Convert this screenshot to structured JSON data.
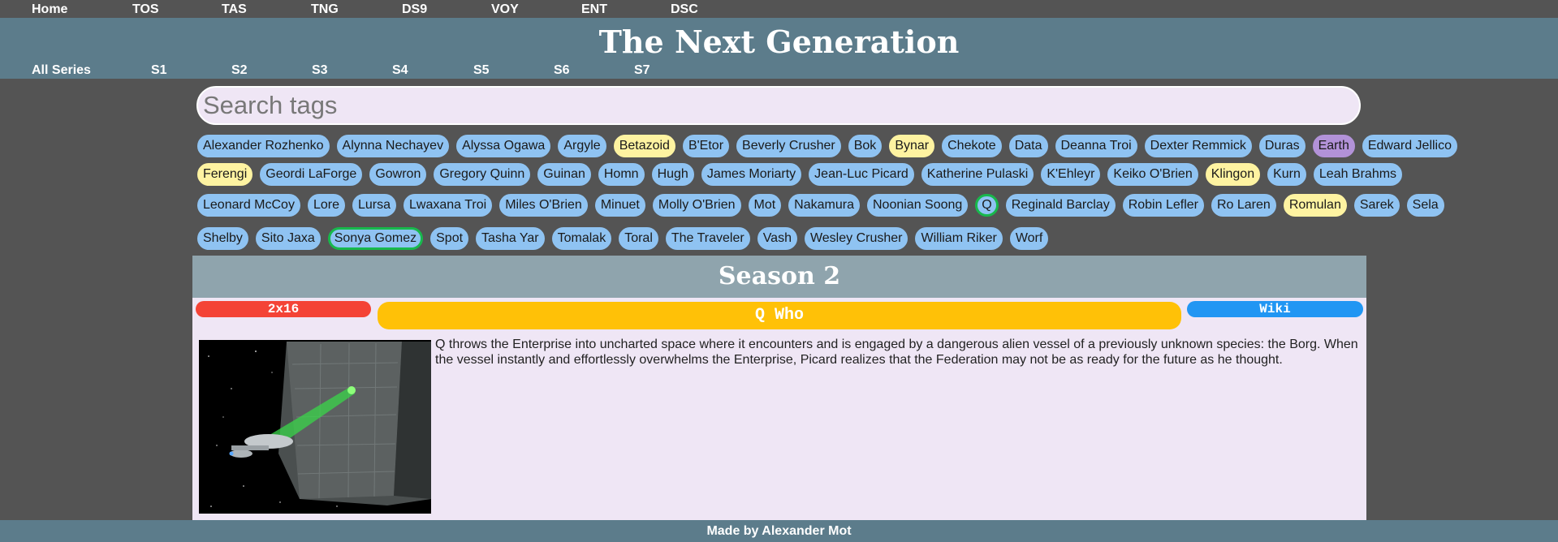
{
  "topnav": [
    "Home",
    "TOS",
    "TAS",
    "TNG",
    "DS9",
    "VOY",
    "ENT",
    "DSC"
  ],
  "header": {
    "title": "The Next Generation",
    "seasons": [
      "All Series",
      "S1",
      "S2",
      "S3",
      "S4",
      "S5",
      "S6",
      "S7"
    ]
  },
  "search": {
    "placeholder": "Search tags"
  },
  "tags": [
    {
      "label": "Alexander Rozhenko",
      "color": "blue",
      "selected": false
    },
    {
      "label": "Alynna Nechayev",
      "color": "blue",
      "selected": false
    },
    {
      "label": "Alyssa Ogawa",
      "color": "blue",
      "selected": false
    },
    {
      "label": "Argyle",
      "color": "blue",
      "selected": false
    },
    {
      "label": "Betazoid",
      "color": "yellow",
      "selected": false
    },
    {
      "label": "B'Etor",
      "color": "blue",
      "selected": false
    },
    {
      "label": "Beverly Crusher",
      "color": "blue",
      "selected": false
    },
    {
      "label": "Bok",
      "color": "blue",
      "selected": false
    },
    {
      "label": "Bynar",
      "color": "yellow",
      "selected": false
    },
    {
      "label": "Chekote",
      "color": "blue",
      "selected": false
    },
    {
      "label": "Data",
      "color": "blue",
      "selected": false
    },
    {
      "label": "Deanna Troi",
      "color": "blue",
      "selected": false
    },
    {
      "label": "Dexter Remmick",
      "color": "blue",
      "selected": false
    },
    {
      "label": "Duras",
      "color": "blue",
      "selected": false
    },
    {
      "label": "Earth",
      "color": "purple",
      "selected": false
    },
    {
      "label": "Edward Jellico",
      "color": "blue",
      "selected": false
    },
    {
      "label": "Ferengi",
      "color": "yellow",
      "selected": false
    },
    {
      "label": "Geordi LaForge",
      "color": "blue",
      "selected": false
    },
    {
      "label": "Gowron",
      "color": "blue",
      "selected": false
    },
    {
      "label": "Gregory Quinn",
      "color": "blue",
      "selected": false
    },
    {
      "label": "Guinan",
      "color": "blue",
      "selected": false
    },
    {
      "label": "Homn",
      "color": "blue",
      "selected": false
    },
    {
      "label": "Hugh",
      "color": "blue",
      "selected": false
    },
    {
      "label": "James Moriarty",
      "color": "blue",
      "selected": false
    },
    {
      "label": "Jean-Luc Picard",
      "color": "blue",
      "selected": false
    },
    {
      "label": "Katherine Pulaski",
      "color": "blue",
      "selected": false
    },
    {
      "label": "K'Ehleyr",
      "color": "blue",
      "selected": false
    },
    {
      "label": "Keiko O'Brien",
      "color": "blue",
      "selected": false
    },
    {
      "label": "Klingon",
      "color": "yellow",
      "selected": false
    },
    {
      "label": "Kurn",
      "color": "blue",
      "selected": false
    },
    {
      "label": "Leah Brahms",
      "color": "blue",
      "selected": false
    },
    {
      "label": "Leonard McCoy",
      "color": "blue",
      "selected": false
    },
    {
      "label": "Lore",
      "color": "blue",
      "selected": false
    },
    {
      "label": "Lursa",
      "color": "blue",
      "selected": false
    },
    {
      "label": "Lwaxana Troi",
      "color": "blue",
      "selected": false
    },
    {
      "label": "Miles O'Brien",
      "color": "blue",
      "selected": false
    },
    {
      "label": "Minuet",
      "color": "blue",
      "selected": false
    },
    {
      "label": "Molly O'Brien",
      "color": "blue",
      "selected": false
    },
    {
      "label": "Mot",
      "color": "blue",
      "selected": false
    },
    {
      "label": "Nakamura",
      "color": "blue",
      "selected": false
    },
    {
      "label": "Noonian Soong",
      "color": "blue",
      "selected": false
    },
    {
      "label": "Q",
      "color": "blue",
      "selected": true
    },
    {
      "label": "Reginald Barclay",
      "color": "blue",
      "selected": false
    },
    {
      "label": "Robin Lefler",
      "color": "blue",
      "selected": false
    },
    {
      "label": "Ro Laren",
      "color": "blue",
      "selected": false
    },
    {
      "label": "Romulan",
      "color": "yellow",
      "selected": false
    },
    {
      "label": "Sarek",
      "color": "blue",
      "selected": false
    },
    {
      "label": "Sela",
      "color": "blue",
      "selected": false
    },
    {
      "label": "Shelby",
      "color": "blue",
      "selected": false
    },
    {
      "label": "Sito Jaxa",
      "color": "blue",
      "selected": false
    },
    {
      "label": "Sonya Gomez",
      "color": "blue",
      "selected": true
    },
    {
      "label": "Spot",
      "color": "blue",
      "selected": false
    },
    {
      "label": "Tasha Yar",
      "color": "blue",
      "selected": false
    },
    {
      "label": "Tomalak",
      "color": "blue",
      "selected": false
    },
    {
      "label": "Toral",
      "color": "blue",
      "selected": false
    },
    {
      "label": "The Traveler",
      "color": "blue",
      "selected": false
    },
    {
      "label": "Vash",
      "color": "blue",
      "selected": false
    },
    {
      "label": "Wesley Crusher",
      "color": "blue",
      "selected": false
    },
    {
      "label": "William Riker",
      "color": "blue",
      "selected": false
    },
    {
      "label": "Worf",
      "color": "blue",
      "selected": false
    }
  ],
  "season_header": "Season 2",
  "episode": {
    "number": "2x16",
    "title": "Q Who",
    "wiki_label": "Wiki",
    "description": "Q throws the Enterprise into uncharted space where it encounters and is engaged by a dangerous alien vessel of a previously unknown species: the Borg. When the vessel instantly and effortlessly overwhelms the Enterprise, Picard realizes that the Federation may not be as ready for the future as he thought."
  },
  "footer": "Made by Alexander Mot",
  "colors": {
    "header_bg": "#5c7c8b",
    "page_bg": "#545454",
    "tag_blue": "#8fc3f2",
    "tag_yellow": "#fef3a1",
    "tag_purple": "#b292d8",
    "tag_selected_border": "#18b84c",
    "episode_number_bg": "#f44336",
    "episode_title_bg": "#ffc107",
    "wiki_bg": "#2196f3",
    "card_bg": "#efe6f5",
    "season_bg": "#8fa4ad"
  }
}
